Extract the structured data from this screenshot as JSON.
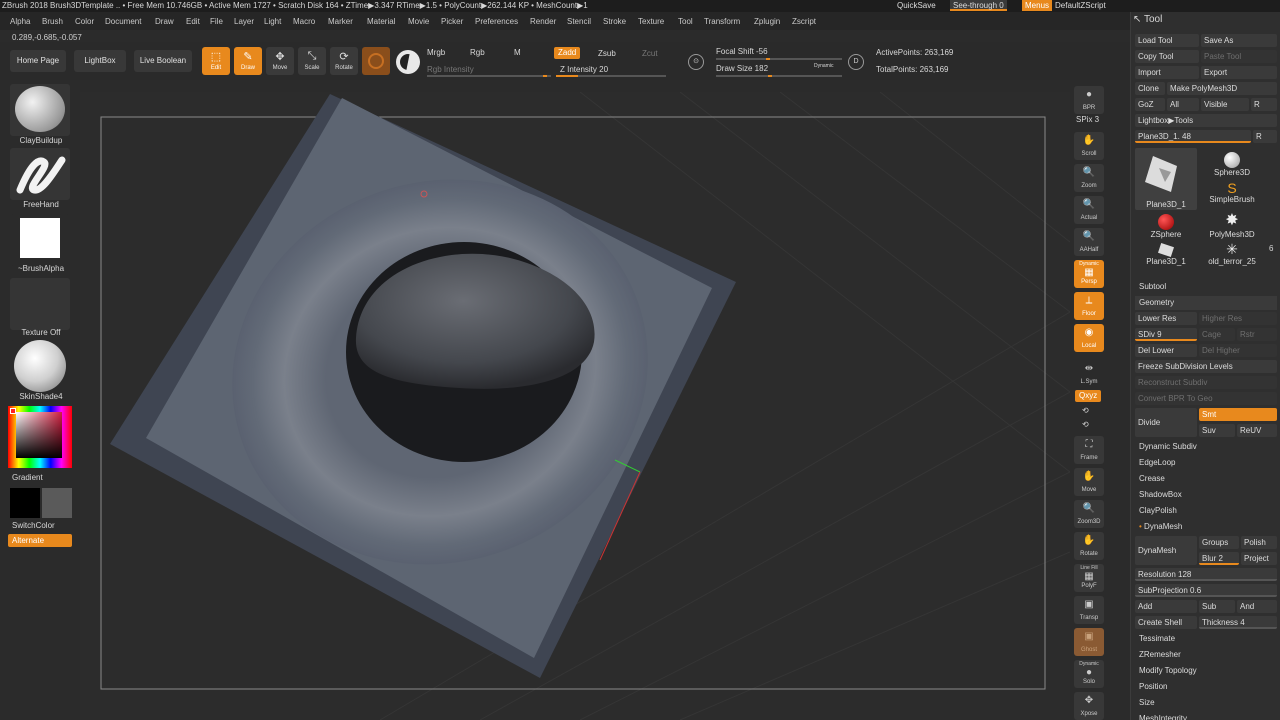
{
  "title_bar": {
    "text": "ZBrush 2018    Brush3DTemplate  .. • Free Mem 10.746GB • Active Mem 1727 • Scratch Disk 164 • ZTime▶3.347 RTime▶1.5 • PolyCount▶262.144 KP • MeshCount▶1",
    "quicksave": "QuickSave",
    "see_through": "See-through  0",
    "menus": "Menus",
    "default_zscript": "DefaultZScript"
  },
  "menu": [
    "Alpha",
    "Brush",
    "Color",
    "Document",
    "Draw",
    "Edit",
    "File",
    "Layer",
    "Light",
    "Macro",
    "Marker",
    "Material",
    "Movie",
    "Picker",
    "Preferences",
    "Render",
    "Stencil",
    "Stroke",
    "Texture",
    "Tool",
    "Transform",
    "Zplugin",
    "Zscript"
  ],
  "coords": "0.289,-0.685,-0.057",
  "toolbar": {
    "home_page": "Home Page",
    "lightbox": "LightBox",
    "live_boolean": "Live Boolean",
    "edit": "Edit",
    "draw": "Draw",
    "move": "Move",
    "scale": "Scale",
    "rotate": "Rotate",
    "mrgb": "Mrgb",
    "rgb": "Rgb",
    "m": "M",
    "rgb_intensity": "Rgb Intensity",
    "zadd": "Zadd",
    "zsub": "Zsub",
    "zcut": "Zcut",
    "z_intensity": "Z Intensity 20",
    "focal_shift": "Focal Shift -56",
    "draw_size": "Draw Size 182",
    "dynamic": "Dynamic",
    "active_points": "ActivePoints: 263,169",
    "total_points": "TotalPoints: 263,169"
  },
  "left_shelf": {
    "brush": "ClayBuildup",
    "stroke": "FreeHand",
    "alpha": "~BrushAlpha",
    "texture": "Texture Off",
    "material": "SkinShade4",
    "gradient": "Gradient",
    "switch_color": "SwitchColor",
    "alternate": "Alternate"
  },
  "rail": [
    "BPR",
    "SPix 3",
    "Scroll",
    "Zoom",
    "Actual",
    "AAHalf",
    "Persp",
    "Floor",
    "Local",
    "L.Sym",
    "Qxyz",
    "Frame",
    "Move",
    "Zoom3D",
    "Rotate",
    "Line Fill",
    "PolyF",
    "Transp",
    "Ghost",
    "Solo",
    "Xpose"
  ],
  "rail_dynamic": "Dynamic",
  "palette": {
    "title": "Tool",
    "load_tool": "Load Tool",
    "save_as": "Save As",
    "copy_tool": "Copy Tool",
    "paste_tool": "Paste Tool",
    "import": "Import",
    "export": "Export",
    "clone": "Clone",
    "make_polymesh": "Make PolyMesh3D",
    "goz": "GoZ",
    "all": "All",
    "visible": "Visible",
    "r": "R",
    "lightbox_tools": "Lightbox▶Tools",
    "plane_slider": "Plane3D_1. 48",
    "tools": [
      "Plane3D_1",
      "Sphere3D",
      "SimpleBrush",
      "ZSphere",
      "PolyMesh3D",
      "Plane3D_1",
      "old_terror_25"
    ],
    "tool_count": "6",
    "subtool": "Subtool",
    "geometry": "Geometry",
    "lower_res": "Lower Res",
    "higher_res": "Higher Res",
    "sdiv": "SDiv 9",
    "cage": "Cage",
    "rstr": "Rstr",
    "del_lower": "Del Lower",
    "del_higher": "Del Higher",
    "freeze": "Freeze SubDivision Levels",
    "reconstruct": "Reconstruct Subdiv",
    "convert_bpr": "Convert BPR To Geo",
    "divide": "Divide",
    "smt": "Smt",
    "suv": "Suv",
    "reuv": "ReUV",
    "sections": [
      "Dynamic Subdiv",
      "EdgeLoop",
      "Crease",
      "ShadowBox",
      "ClayPolish",
      "DynaMesh"
    ],
    "dynamesh_btn": "DynaMesh",
    "groups": "Groups",
    "polish": "Polish",
    "blur": "Blur 2",
    "project": "Project",
    "resolution": "Resolution 128",
    "subprojection": "SubProjection 0.6",
    "add": "Add",
    "sub": "Sub",
    "and": "And",
    "create_shell": "Create Shell",
    "thickness": "Thickness 4",
    "more": [
      "Tessimate",
      "ZRemesher",
      "Modify Topology",
      "Position",
      "Size",
      "MeshIntegrity"
    ]
  },
  "colors": {
    "accent": "#e8891d",
    "bg": "#2b2b2b"
  }
}
